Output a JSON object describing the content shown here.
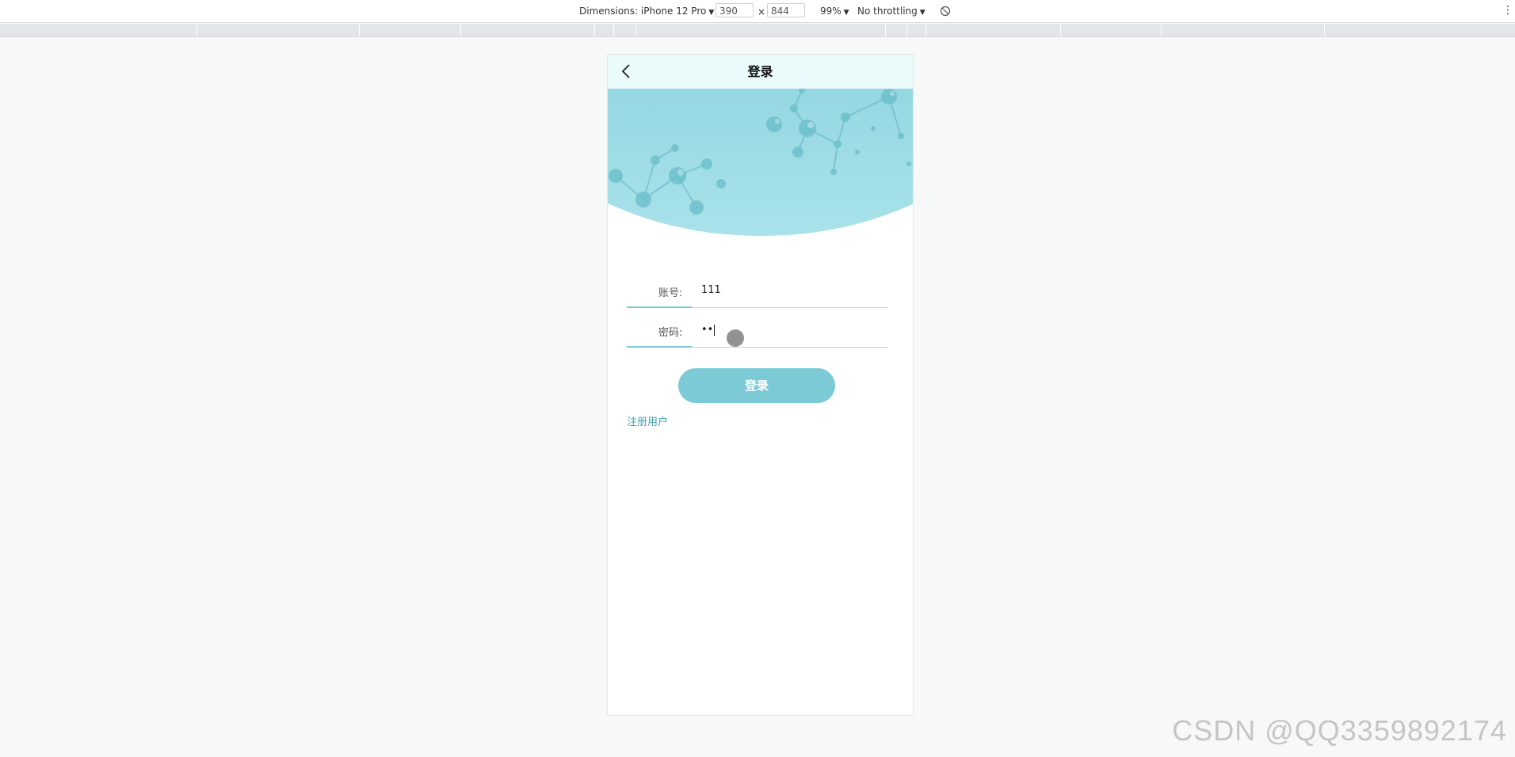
{
  "devtools": {
    "dimensions_label": "Dimensions: iPhone 12 Pro",
    "width_value": "390",
    "times": "×",
    "height_value": "844",
    "zoom": "99%",
    "throttling": "No throttling"
  },
  "navbar": {
    "title": "登录"
  },
  "form": {
    "account_label": "账号:",
    "account_value": "111",
    "password_label": "密码:",
    "password_value": "••"
  },
  "login_button": "登录",
  "register_link": "注册用户",
  "watermark": "CSDN @QQ3359892174",
  "colors": {
    "accent": "#7ccad5",
    "link": "#3ea3b1",
    "navbar_bg": "#e9fbfb"
  }
}
